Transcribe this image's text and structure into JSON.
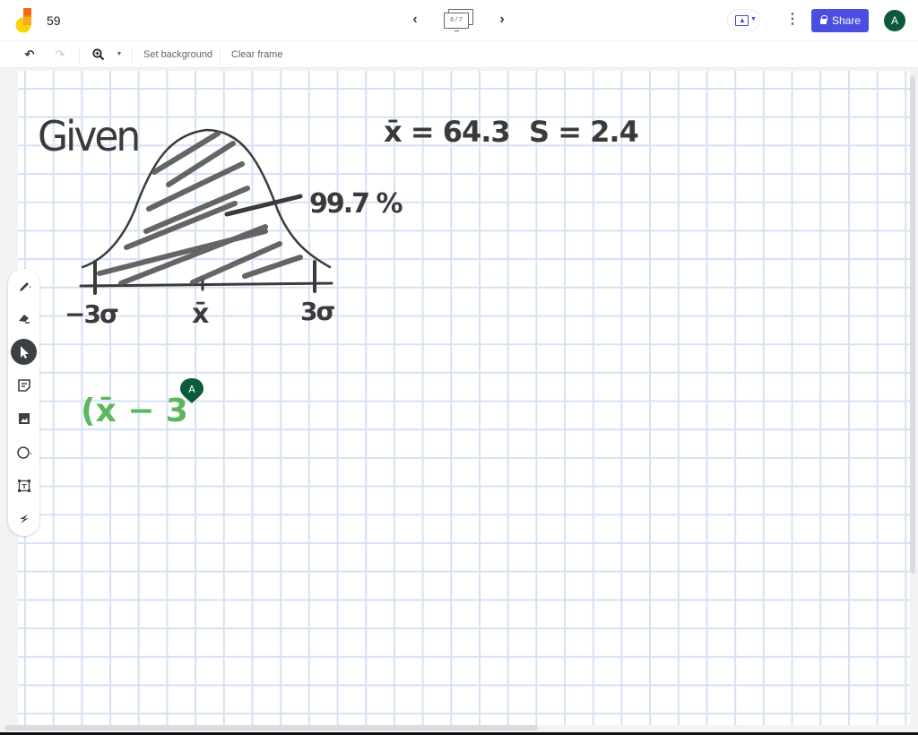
{
  "app": {
    "title": "59",
    "frame_counter": "6 / 7",
    "share_label": "Share",
    "avatar_initial": "A",
    "icons": {
      "logo": "jamboard-logo-icon",
      "prev": "chevron-left-icon",
      "next": "chevron-right-icon",
      "frames": "frames-icon",
      "present": "present-icon",
      "more": "more-vert-icon",
      "lock": "lock-icon"
    },
    "colors": {
      "share": "#4b4ee0",
      "avatar": "#0b5b3a",
      "ink_dark": "#3a3a3a",
      "ink_green": "#5cb85c",
      "grid": "#d6e1f5"
    }
  },
  "toolbar": {
    "undo": "undo-icon",
    "redo": "redo-icon",
    "zoom": "zoom-icon",
    "set_background": "Set background",
    "clear_frame": "Clear frame"
  },
  "tools": [
    {
      "name": "pen",
      "icon": "pen-icon"
    },
    {
      "name": "eraser",
      "icon": "eraser-icon"
    },
    {
      "name": "select",
      "icon": "cursor-icon",
      "active": true
    },
    {
      "name": "sticky-note",
      "icon": "sticky-note-icon"
    },
    {
      "name": "image",
      "icon": "image-icon"
    },
    {
      "name": "circle",
      "icon": "circle-icon"
    },
    {
      "name": "text-box",
      "icon": "text-box-icon"
    },
    {
      "name": "laser",
      "icon": "laser-icon"
    }
  ],
  "canvas": {
    "given_label": "Given",
    "mean_eq": "x̄ = 64.3",
    "sd_eq": "S = 2.4",
    "percent_label": "99.7 %",
    "axis_left": "−3σ",
    "axis_mid": "x̄",
    "axis_right": "3σ",
    "green_expr": "(x̄ − 3",
    "collaborator_cursor": "A"
  }
}
